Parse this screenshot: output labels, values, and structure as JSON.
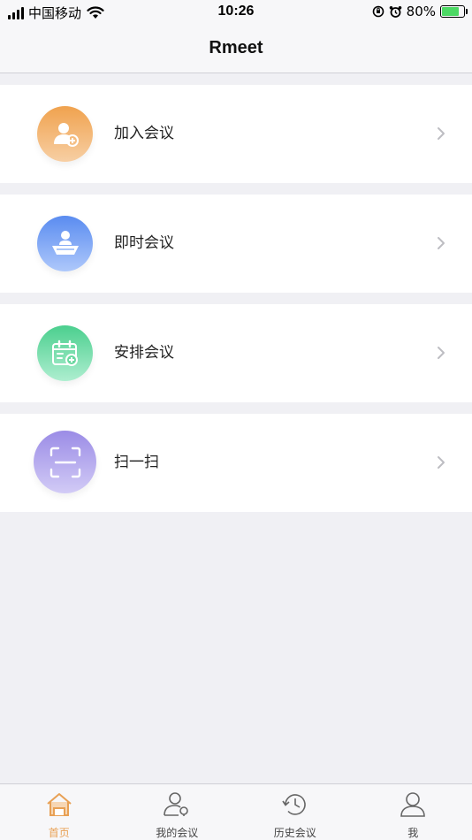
{
  "status_bar": {
    "carrier": "中国移动",
    "time": "10:26",
    "battery_percent": "80%",
    "battery_level": 0.8
  },
  "nav": {
    "title": "Rmeet"
  },
  "menu": [
    {
      "label": "加入会议",
      "icon": "add-user-icon",
      "colors": [
        "#f0a24e",
        "#f7cfa4"
      ]
    },
    {
      "label": "即时会议",
      "icon": "presenter-icon",
      "colors": [
        "#5a8cf0",
        "#aec8fb"
      ]
    },
    {
      "label": "安排会议",
      "icon": "calendar-add-icon",
      "colors": [
        "#4bcf8e",
        "#aeeed0"
      ]
    },
    {
      "label": "扫一扫",
      "icon": "scan-icon",
      "colors": [
        "#9b8ce6",
        "#d2cbf6"
      ]
    }
  ],
  "tabs": [
    {
      "label": "首页",
      "icon": "home-icon",
      "active": true
    },
    {
      "label": "我的会议",
      "icon": "my-meetings-icon",
      "active": false
    },
    {
      "label": "历史会议",
      "icon": "history-icon",
      "active": false
    },
    {
      "label": "我",
      "icon": "profile-icon",
      "active": false
    }
  ],
  "colors": {
    "accent": "#e8a054",
    "background": "#f0f0f4"
  }
}
